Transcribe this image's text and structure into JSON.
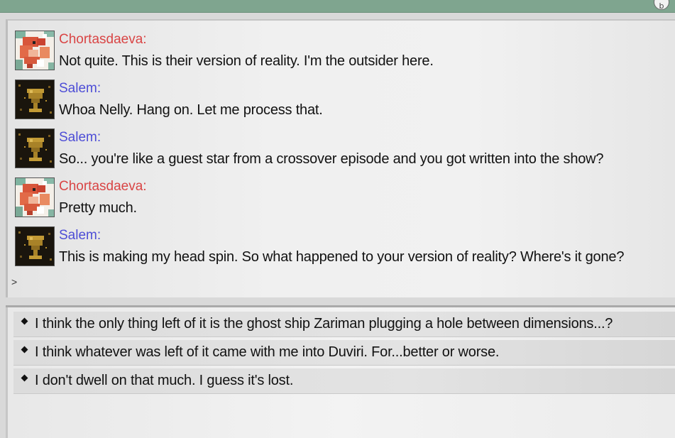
{
  "window": {
    "top_button_glyph": "b"
  },
  "colors": {
    "speaker_chortasdaeva": "#d94545",
    "speaker_salem": "#4d4dd6"
  },
  "messages": [
    {
      "speaker": "Chortasdaeva:",
      "avatar": "dragon-portrait-icon",
      "text": "Not quite. This is their version of reality. I'm the outsider here."
    },
    {
      "speaker": "Salem:",
      "avatar": "chalice-portrait-icon",
      "text": "Whoa Nelly. Hang on. Let me process that."
    },
    {
      "speaker": "Salem:",
      "avatar": "chalice-portrait-icon",
      "text": "So... you're like a guest star from a crossover episode and you got written into the show?"
    },
    {
      "speaker": "Chortasdaeva:",
      "avatar": "dragon-portrait-icon",
      "text": "Pretty much."
    },
    {
      "speaker": "Salem:",
      "avatar": "chalice-portrait-icon",
      "text": "This is making my head spin. So what happened to your version of reality? Where's it gone?"
    }
  ],
  "prompt": ">",
  "choices": [
    "I think the only thing left of it is the ghost ship Zariman plugging a hole between dimensions...?",
    "I think whatever was left of it came with me into Duviri. For...better or worse.",
    "I don't dwell on that much. I guess it's lost."
  ]
}
